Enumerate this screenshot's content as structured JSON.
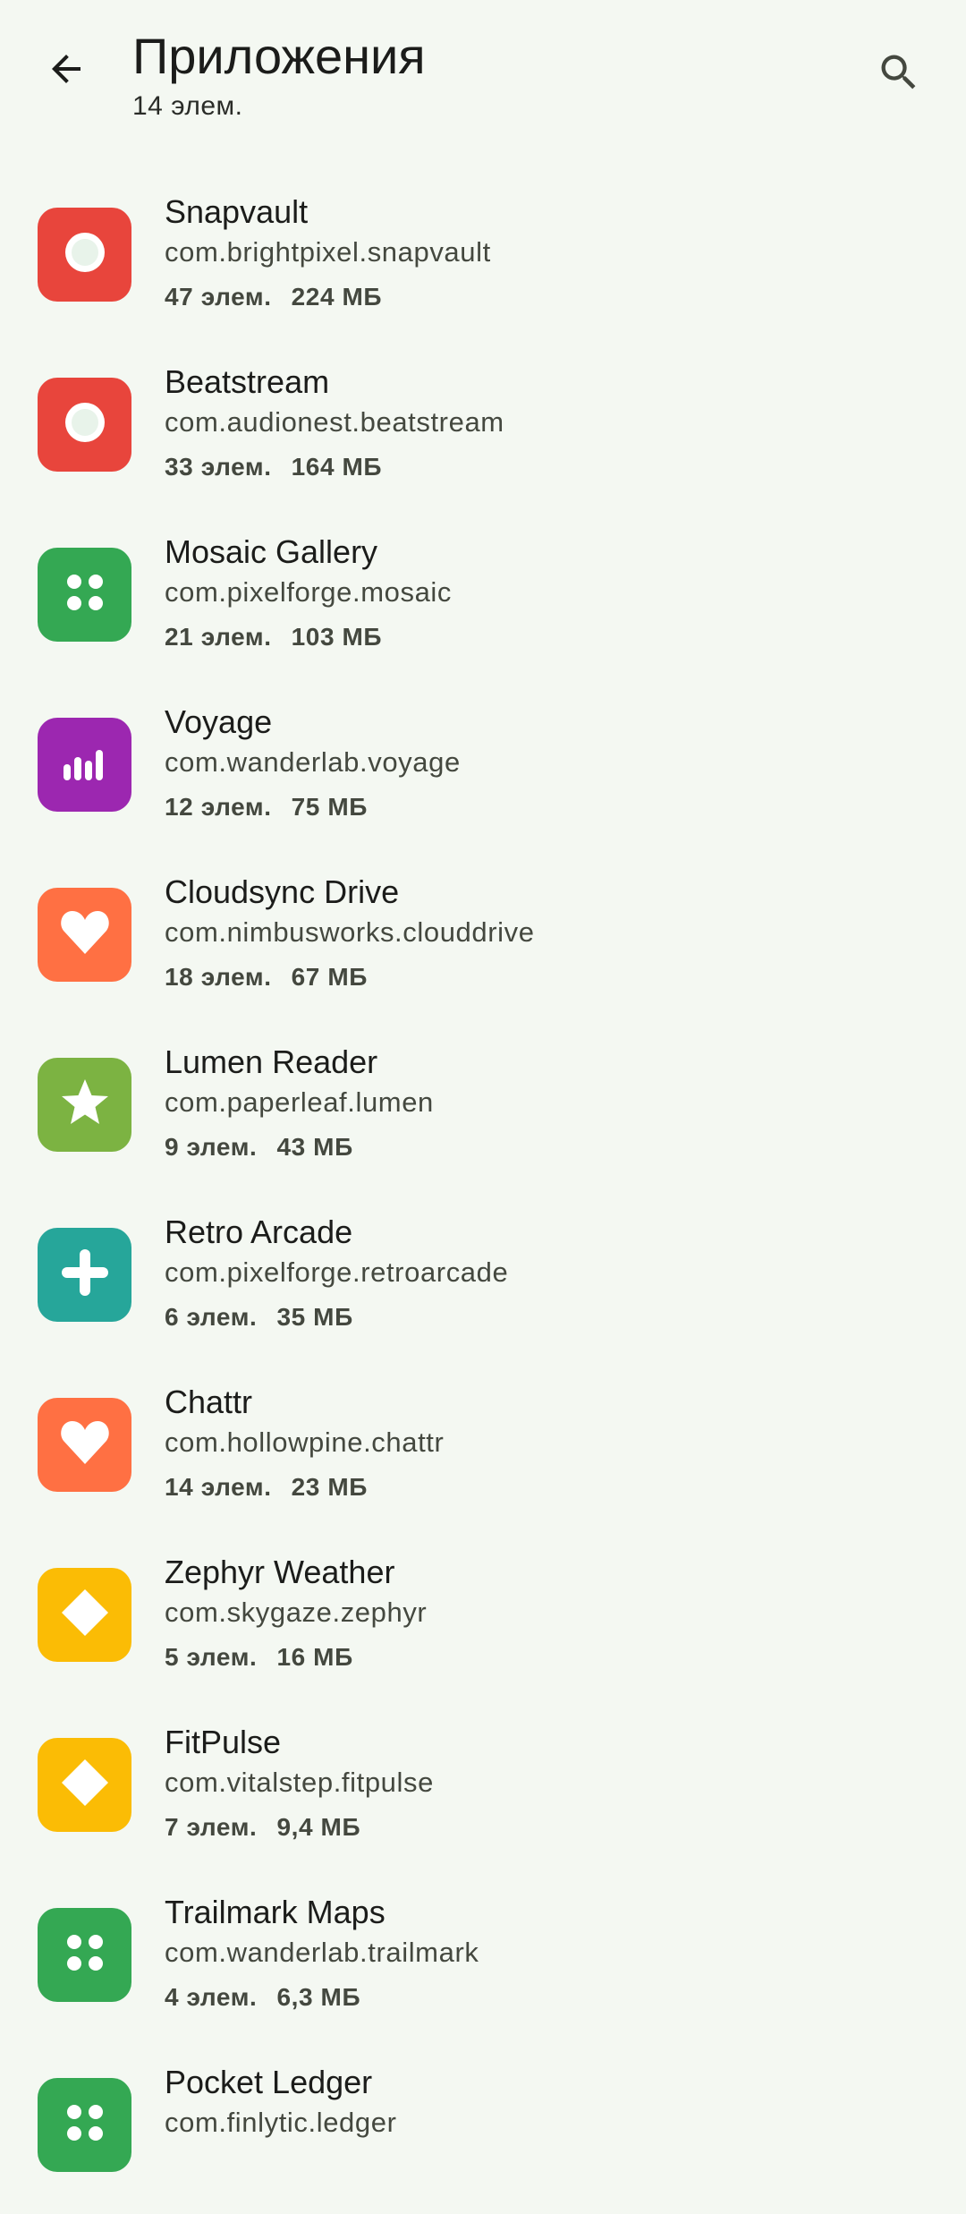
{
  "header": {
    "title": "Приложения",
    "subtitle": "14 элем.",
    "back_icon": "arrow-back-icon",
    "search_icon": "search-icon"
  },
  "apps": [
    {
      "name": "Snapvault",
      "package": "com.brightpixel.snapvault",
      "items": "47 элем.",
      "size": "224 МБ",
      "icon": "circle-icon",
      "color": "#e8453c"
    },
    {
      "name": "Beatstream",
      "package": "com.audionest.beatstream",
      "items": "33 элем.",
      "size": "164 МБ",
      "icon": "circle-icon",
      "color": "#e8453c"
    },
    {
      "name": "Mosaic Gallery",
      "package": "com.pixelforge.mosaic",
      "items": "21 элем.",
      "size": "103 МБ",
      "icon": "grid-dots-icon",
      "color": "#34a853"
    },
    {
      "name": "Voyage",
      "package": "com.wanderlab.voyage",
      "items": "12 элем.",
      "size": "75 МБ",
      "icon": "bars-icon",
      "color": "#9c27b0"
    },
    {
      "name": "Cloudsync Drive",
      "package": "com.nimbusworks.clouddrive",
      "items": "18 элем.",
      "size": "67 МБ",
      "icon": "heart-icon",
      "color": "#ff7043"
    },
    {
      "name": "Lumen Reader",
      "package": "com.paperleaf.lumen",
      "items": "9 элем.",
      "size": "43 МБ",
      "icon": "star-icon",
      "color": "#7cb342"
    },
    {
      "name": "Retro Arcade",
      "package": "com.pixelforge.retroarcade",
      "items": "6 элем.",
      "size": "35 МБ",
      "icon": "plus-icon",
      "color": "#26a69a"
    },
    {
      "name": "Chattr",
      "package": "com.hollowpine.chattr",
      "items": "14 элем.",
      "size": "23 МБ",
      "icon": "heart-icon",
      "color": "#ff7043"
    },
    {
      "name": "Zephyr Weather",
      "package": "com.skygaze.zephyr",
      "items": "5 элем.",
      "size": "16 МБ",
      "icon": "diamond-icon",
      "color": "#fbbc05"
    },
    {
      "name": "FitPulse",
      "package": "com.vitalstep.fitpulse",
      "items": "7 элем.",
      "size": "9,4 МБ",
      "icon": "diamond-icon",
      "color": "#fbbc05"
    },
    {
      "name": "Trailmark Maps",
      "package": "com.wanderlab.trailmark",
      "items": "4 элем.",
      "size": "6,3 МБ",
      "icon": "grid-dots-icon",
      "color": "#34a853"
    },
    {
      "name": "Pocket Ledger",
      "package": "com.finlytic.ledger",
      "items": "",
      "size": "",
      "icon": "grid-dots-icon",
      "color": "#34a853"
    }
  ]
}
